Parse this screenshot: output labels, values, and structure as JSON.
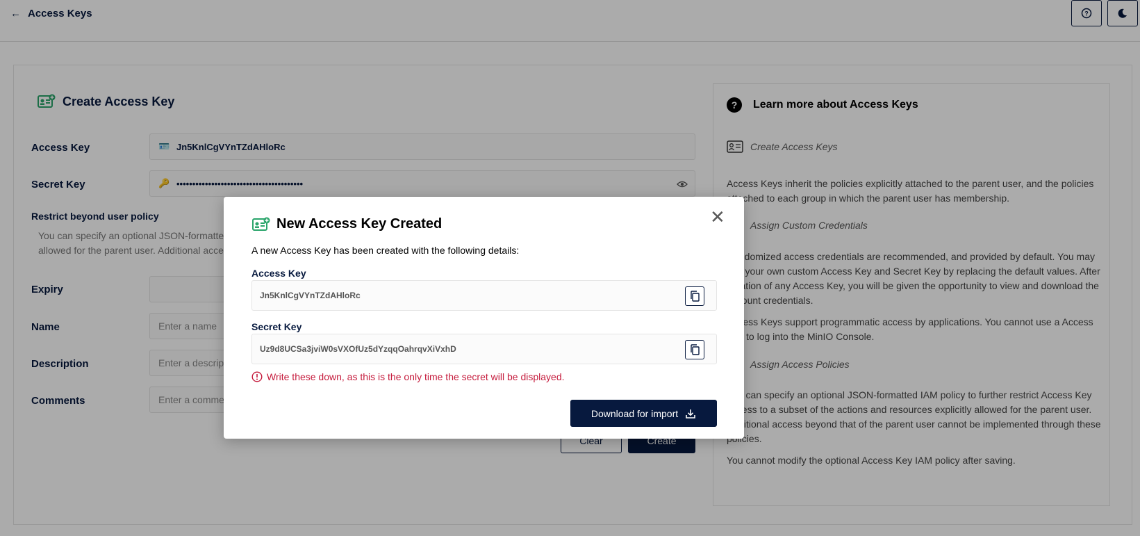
{
  "header": {
    "back_label": "Access Keys",
    "help_icon": "help-circle-icon",
    "theme_icon": "moon-icon"
  },
  "form": {
    "title": "Create Access Key",
    "access_key_label": "Access Key",
    "access_key_value": "Jn5KnlCgVYnTZdAHloRc",
    "secret_key_label": "Secret Key",
    "secret_key_masked": "••••••••••••••••••••••••••••••••••••••••",
    "restrict_title": "Restrict beyond user policy",
    "restrict_desc": "You can specify an optional JSON-formatted IAM policy to further restrict Access Key access to a subset of the actions and resources explicitly allowed for the parent user. Additional access beyond that of the parent user cannot be implemented through these policies.",
    "expiry_label": "Expiry",
    "name_label": "Name",
    "name_placeholder": "Enter a name",
    "description_label": "Description",
    "description_placeholder": "Enter a description",
    "comments_label": "Comments",
    "comments_placeholder": "Enter a comment",
    "clear_label": "Clear",
    "create_label": "Create"
  },
  "help": {
    "title": "Learn more about Access Keys",
    "sub1": "Create Access Keys",
    "p1": "Access Keys inherit the policies explicitly attached to the parent user, and the policies attached to each group in which the parent user has membership.",
    "sub2": "Assign Custom Credentials",
    "p2": "Randomized access credentials are recommended, and provided by default. You may use your own custom Access Key and Secret Key by replacing the default values. After creation of any Access Key, you will be given the opportunity to view and download the account credentials.",
    "p3": "Access Keys support programmatic access by applications. You cannot use a Access Key to log into the MinIO Console.",
    "sub3": "Assign Access Policies",
    "p4": "You can specify an optional JSON-formatted IAM policy to further restrict Access Key access to a subset of the actions and resources explicitly allowed for the parent user. Additional access beyond that of the parent user cannot be implemented through these policies.",
    "p5": "You cannot modify the optional Access Key IAM policy after saving."
  },
  "modal": {
    "title": "New Access Key Created",
    "description": "A new Access Key has been created with the following details:",
    "access_key_label": "Access Key",
    "access_key_value": "Jn5KnlCgVYnTZdAHloRc",
    "secret_key_label": "Secret Key",
    "secret_key_value": "Uz9d8UCSa3jviW0sVXOfUz5dYzqqOahrqvXiVxhD",
    "warning": "Write these down, as this is the only time the secret will be displayed.",
    "download_label": "Download for import",
    "colors": {
      "primary": "#07193e",
      "warning": "#c51b3c",
      "icon_green": "#2aa56b"
    }
  }
}
